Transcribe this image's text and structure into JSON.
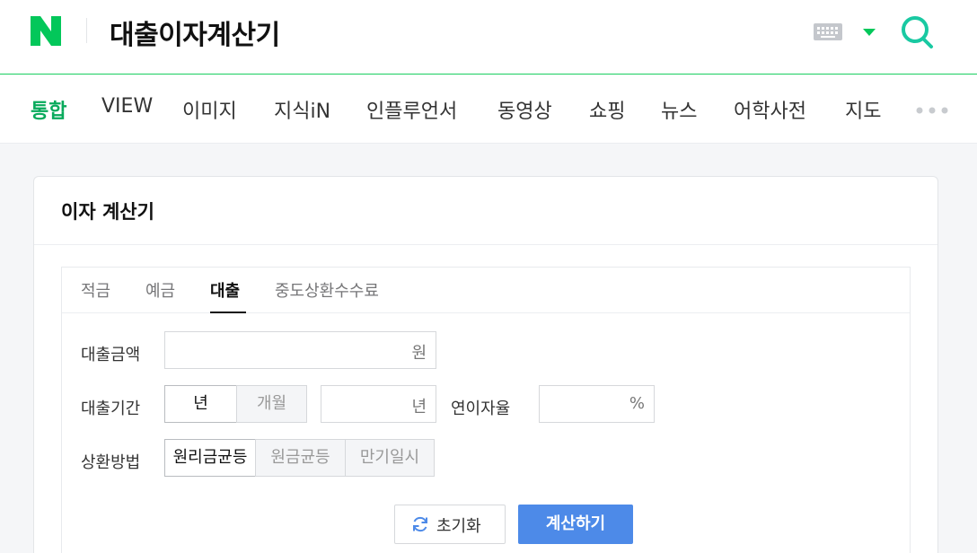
{
  "header": {
    "query": "대출이자계산기",
    "colors": {
      "brand": "#03c75a",
      "search": "#19c9a2"
    }
  },
  "nav": {
    "items": [
      {
        "label": "통합",
        "active": true
      },
      {
        "label": "VIEW"
      },
      {
        "label": "이미지"
      },
      {
        "label": "지식iN"
      },
      {
        "label": "인플루언서"
      },
      {
        "label": "동영상"
      },
      {
        "label": "쇼핑"
      },
      {
        "label": "뉴스"
      },
      {
        "label": "어학사전"
      },
      {
        "label": "지도"
      }
    ]
  },
  "calculator": {
    "title": "이자 계산기",
    "tabs": [
      {
        "label": "적금"
      },
      {
        "label": "예금"
      },
      {
        "label": "대출",
        "active": true
      },
      {
        "label": "중도상환수수료"
      }
    ],
    "loan_amount": {
      "label": "대출금액",
      "unit": "원",
      "value": ""
    },
    "loan_period": {
      "label": "대출기간",
      "options": [
        "년",
        "개월"
      ],
      "selected": "년",
      "unit": "년",
      "value": ""
    },
    "interest_rate": {
      "label": "연이자율",
      "unit": "%",
      "value": ""
    },
    "repayment": {
      "label": "상환방법",
      "options": [
        "원리금균등",
        "원금균등",
        "만기일시"
      ],
      "selected": "원리금균등"
    },
    "reset_label": "초기화",
    "calc_label": "계산하기",
    "colors": {
      "accent": "#4d8ae8",
      "active_tab": "#09aa5c"
    }
  }
}
